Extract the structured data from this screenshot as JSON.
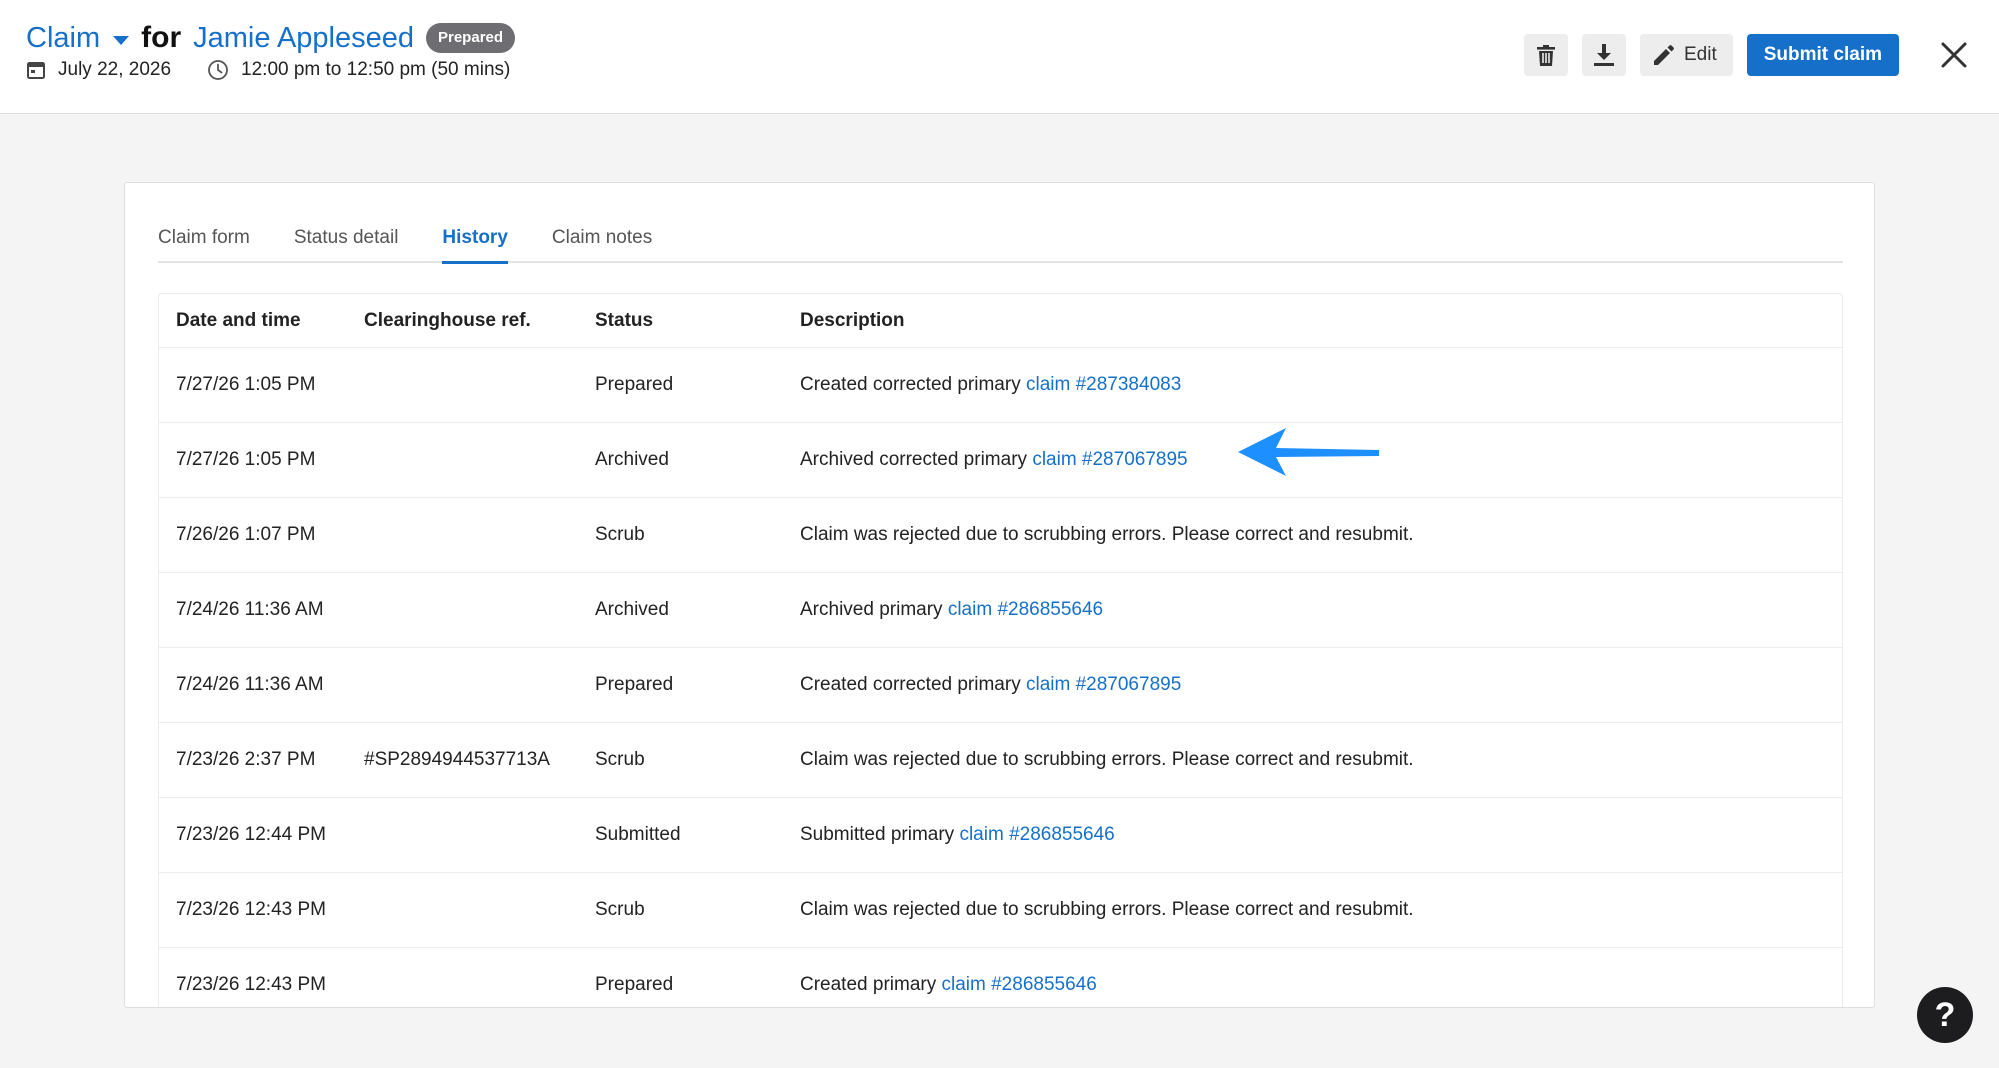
{
  "header": {
    "claim_label": "Claim",
    "for_label": "for",
    "patient_name": "Jamie Appleseed",
    "status_badge": "Prepared",
    "date": "July 22, 2026",
    "time_range": "12:00 pm to 12:50 pm (50 mins)"
  },
  "actions": {
    "delete_icon": "trash-icon",
    "download_icon": "download-icon",
    "edit_label": "Edit",
    "submit_label": "Submit claim",
    "close_icon": "close-icon"
  },
  "tabs": [
    {
      "label": "Claim form",
      "active": false
    },
    {
      "label": "Status detail",
      "active": false
    },
    {
      "label": "History",
      "active": true
    },
    {
      "label": "Claim notes",
      "active": false
    }
  ],
  "table": {
    "headers": [
      "Date and time",
      "Clearinghouse ref.",
      "Status",
      "Description"
    ],
    "rows": [
      {
        "datetime": "7/27/26 1:05 PM",
        "ref": "",
        "status": "Prepared",
        "desc": "Created corrected primary",
        "link": "claim #287384083"
      },
      {
        "datetime": "7/27/26 1:05 PM",
        "ref": "",
        "status": "Archived",
        "desc": "Archived corrected primary",
        "link": "claim #287067895"
      },
      {
        "datetime": "7/26/26 1:07 PM",
        "ref": "",
        "status": "Scrub",
        "desc": "Claim was rejected due to scrubbing errors. Please correct and resubmit.",
        "link": ""
      },
      {
        "datetime": "7/24/26 11:36 AM",
        "ref": "",
        "status": "Archived",
        "desc": "Archived primary",
        "link": "claim #286855646"
      },
      {
        "datetime": "7/24/26 11:36 AM",
        "ref": "",
        "status": "Prepared",
        "desc": "Created corrected primary",
        "link": "claim #287067895"
      },
      {
        "datetime": "7/23/26 2:37 PM",
        "ref": "#SP2894944537713A",
        "status": "Scrub",
        "desc": "Claim was rejected due to scrubbing errors. Please correct and resubmit.",
        "link": ""
      },
      {
        "datetime": "7/23/26 12:44 PM",
        "ref": "",
        "status": "Submitted",
        "desc": "Submitted primary",
        "link": "claim #286855646"
      },
      {
        "datetime": "7/23/26 12:43 PM",
        "ref": "",
        "status": "Scrub",
        "desc": "Claim was rejected due to scrubbing errors. Please correct and resubmit.",
        "link": ""
      },
      {
        "datetime": "7/23/26 12:43 PM",
        "ref": "",
        "status": "Prepared",
        "desc": "Created primary",
        "link": "claim #286855646"
      }
    ]
  },
  "annotation": {
    "arrow_color": "#1e8fff"
  },
  "help": {
    "label": "?"
  },
  "colors": {
    "accent": "#1670c9",
    "badge": "#6e6e72"
  }
}
